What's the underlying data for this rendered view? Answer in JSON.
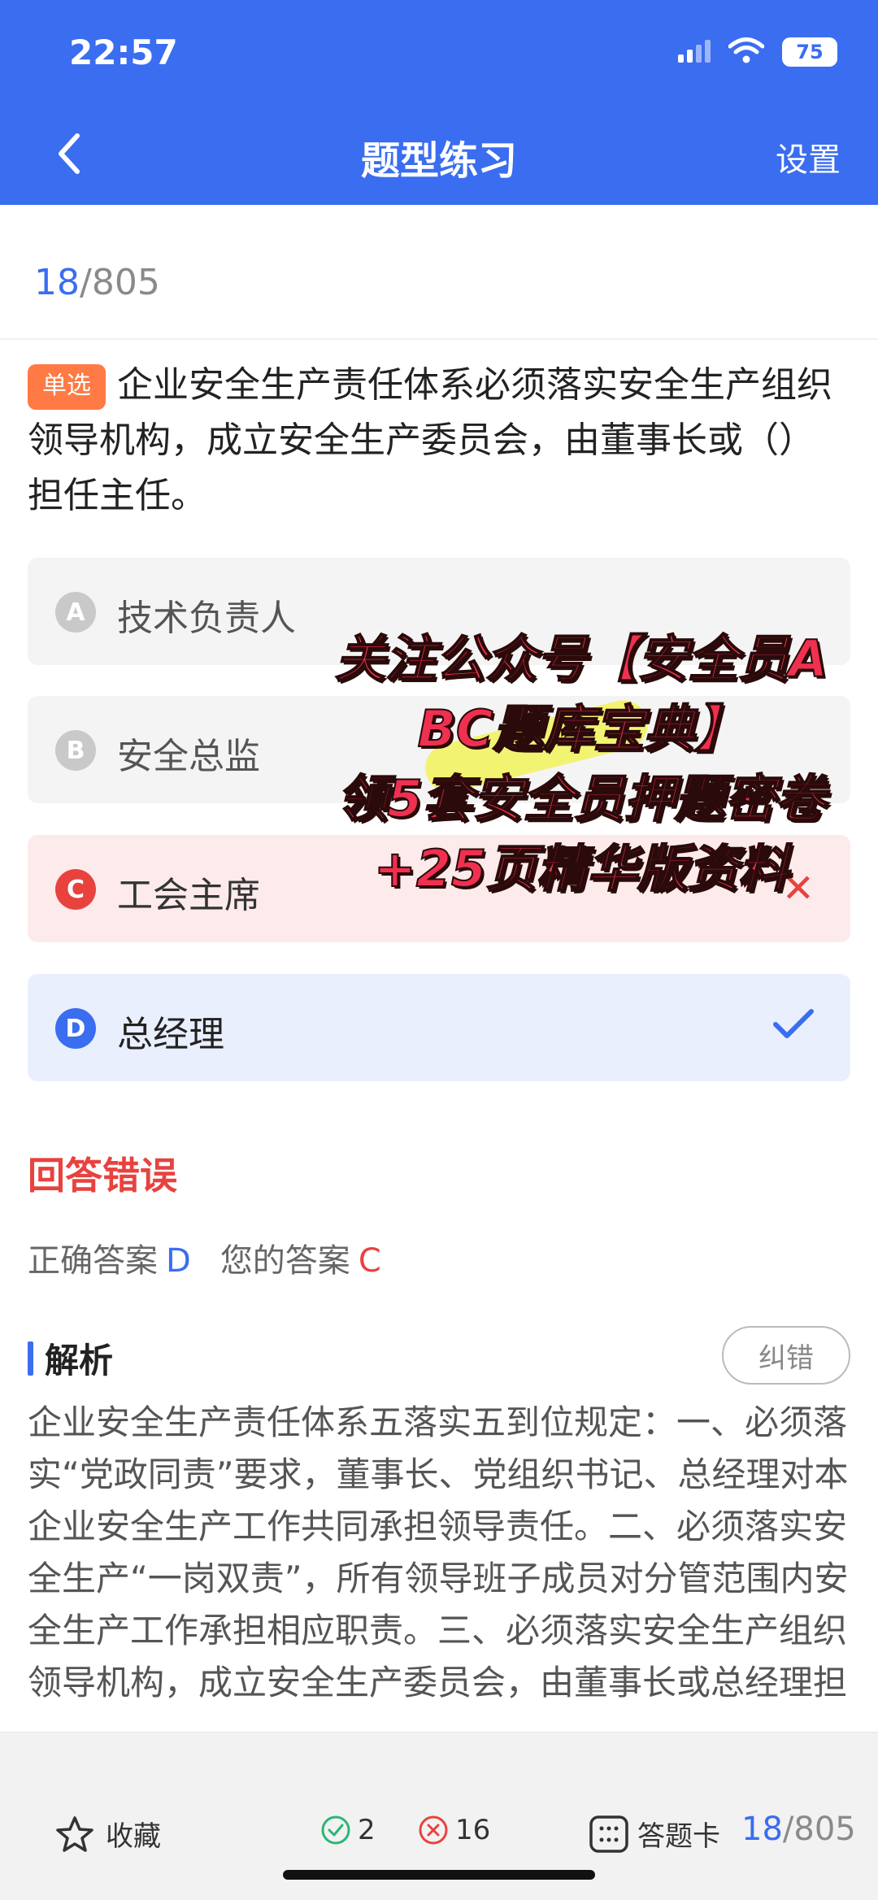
{
  "status_bar": {
    "time": "22:57",
    "battery": "75"
  },
  "nav": {
    "title": "题型练习",
    "settings_label": "设置"
  },
  "progress": {
    "current": "18",
    "total": "/805"
  },
  "question": {
    "type_tag": "单选",
    "text": "企业安全生产责任体系必须落实安全生产组织领导机构，成立安全生产委员会，由董事长或（）担任主任。"
  },
  "options": [
    {
      "letter": "A",
      "text": "技术负责人",
      "state": "normal"
    },
    {
      "letter": "B",
      "text": "安全总监",
      "state": "normal"
    },
    {
      "letter": "C",
      "text": "工会主席",
      "state": "wrong"
    },
    {
      "letter": "D",
      "text": "总经理",
      "state": "correct"
    }
  ],
  "result": {
    "title": "回答错误",
    "correct_label": "正确答案",
    "correct_value": "D",
    "mine_label": "您的答案",
    "mine_value": "C"
  },
  "analysis": {
    "title": "解析",
    "correction_label": "纠错",
    "body": "企业安全生产责任体系五落实五到位规定：一、必须落实“党政同责”要求，董事长、党组织书记、总经理对本企业安全生产工作共同承担领导责任。二、必须落实安全生产“一岗双责”，所有领导班子成员对分管范围内安全生产工作承担相应职责。三、必须落实安全生产组织领导机构，成立安全生产委员会，由董事长或总经理担任主任。"
  },
  "overlay": {
    "line1": "关注公众号【安全员A",
    "line2": "BC题库宝典】",
    "line3": "领5套安全员押题密卷",
    "line4": "+25页精华版资料"
  },
  "bottom_bar": {
    "favorite_label": "收藏",
    "correct_count": "2",
    "wrong_count": "16",
    "answer_card_label": "答题卡",
    "progress_current": "18",
    "progress_total": "/805"
  },
  "colors": {
    "primary": "#3a6df0",
    "error": "#e8423f",
    "tag": "#ff7a45",
    "success": "#2bb673"
  }
}
